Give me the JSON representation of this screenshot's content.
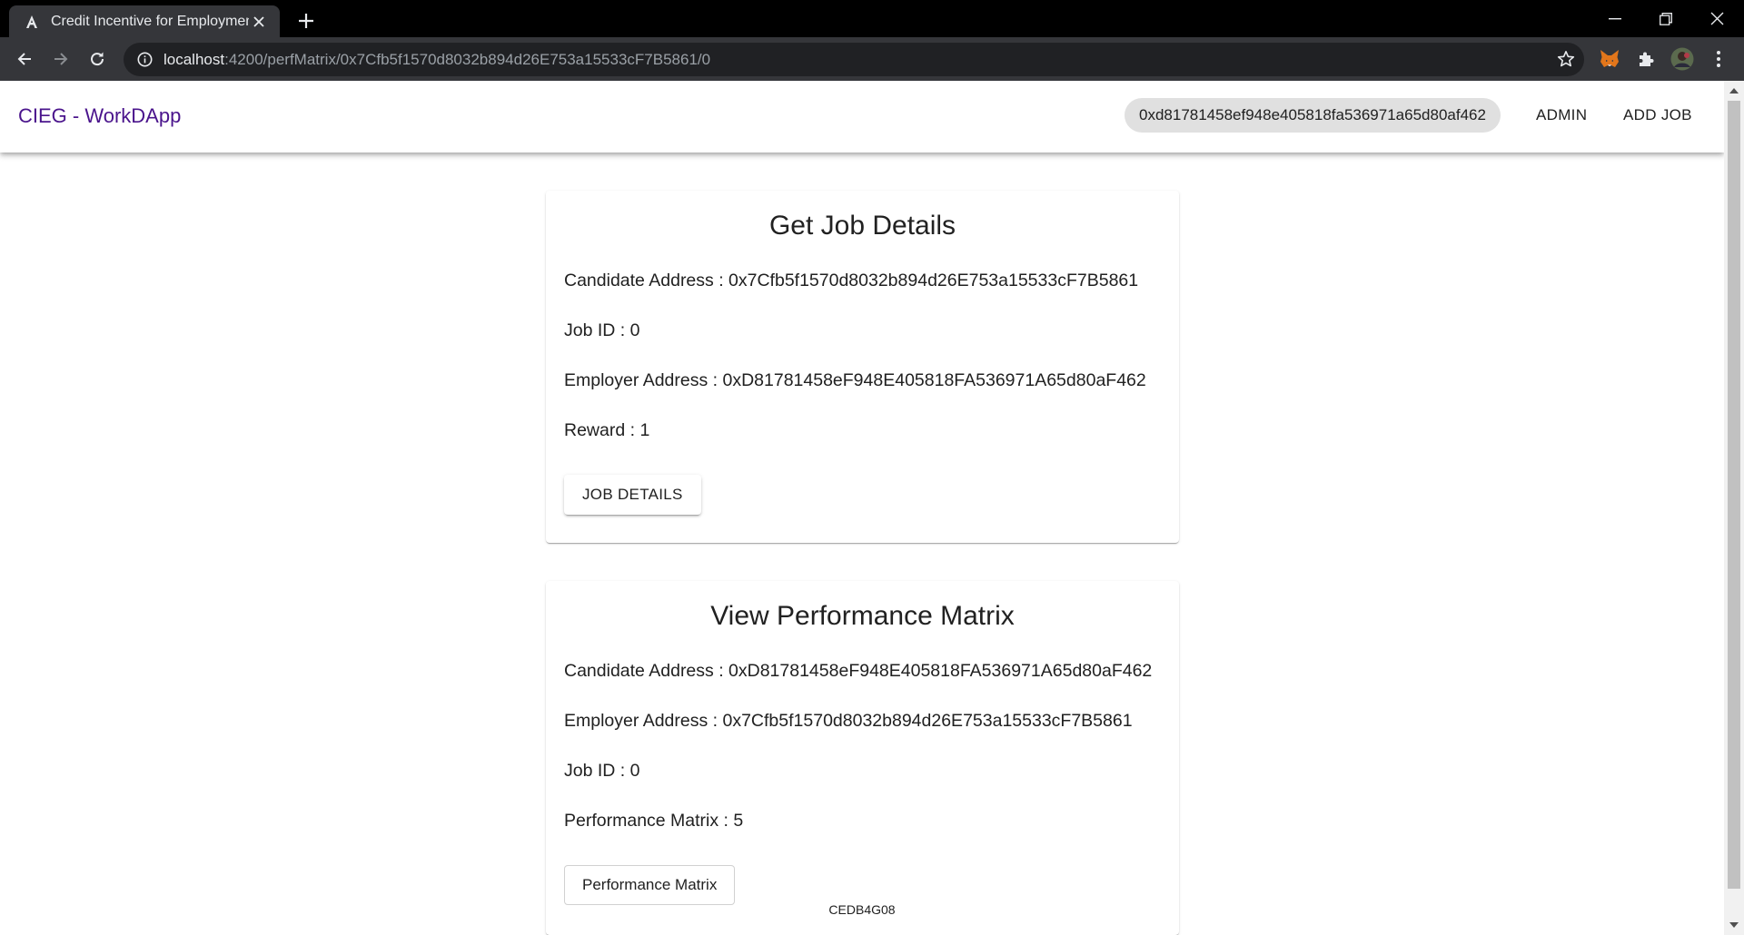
{
  "browser": {
    "tab_title": "Credit Incentive for Employment",
    "url_host": "localhost",
    "url_path": ":4200/perfMatrix/0x7Cfb5f1570d8032b894d26E753a15533cF7B5861/0"
  },
  "app": {
    "brand": "CIEG - WorkDApp",
    "account_address": "0xd81781458ef948e405818fa536971a65d80af462",
    "nav": {
      "admin": "ADMIN",
      "add_job": "ADD JOB"
    }
  },
  "job_card": {
    "title": "Get Job Details",
    "candidate_address": "Candidate Address : 0x7Cfb5f1570d8032b894d26E753a15533cF7B5861",
    "job_id": "Job ID : 0",
    "employer_address": "Employer Address : 0xD81781458eF948E405818FA536971A65d80aF462",
    "reward": "Reward : 1",
    "button": "JOB DETAILS"
  },
  "perf_card": {
    "title": "View Performance Matrix",
    "candidate_address": "Candidate Address : 0xD81781458eF948E405818FA536971A65d80aF462",
    "employer_address": "Employer Address : 0x7Cfb5f1570d8032b894d26E753a15533cF7B5861",
    "job_id": "Job ID : 0",
    "performance_matrix": "Performance Matrix : 5",
    "button": "Performance Matrix"
  },
  "footer_code": "CEDB4G08",
  "icons": {
    "favicon": "angular-a-icon",
    "back": "arrow-left-icon",
    "forward": "arrow-right-icon",
    "reload": "reload-icon",
    "site_info": "info-circle-icon",
    "bookmark": "star-icon",
    "metamask": "fox-icon",
    "extensions": "puzzle-icon",
    "profile": "avatar",
    "menu": "kebab-menu-icon"
  },
  "colors": {
    "brand": "#4a148c",
    "chrome_dark": "#35363a",
    "tabstrip": "#000000",
    "chip_bg": "#e0e0e0"
  }
}
